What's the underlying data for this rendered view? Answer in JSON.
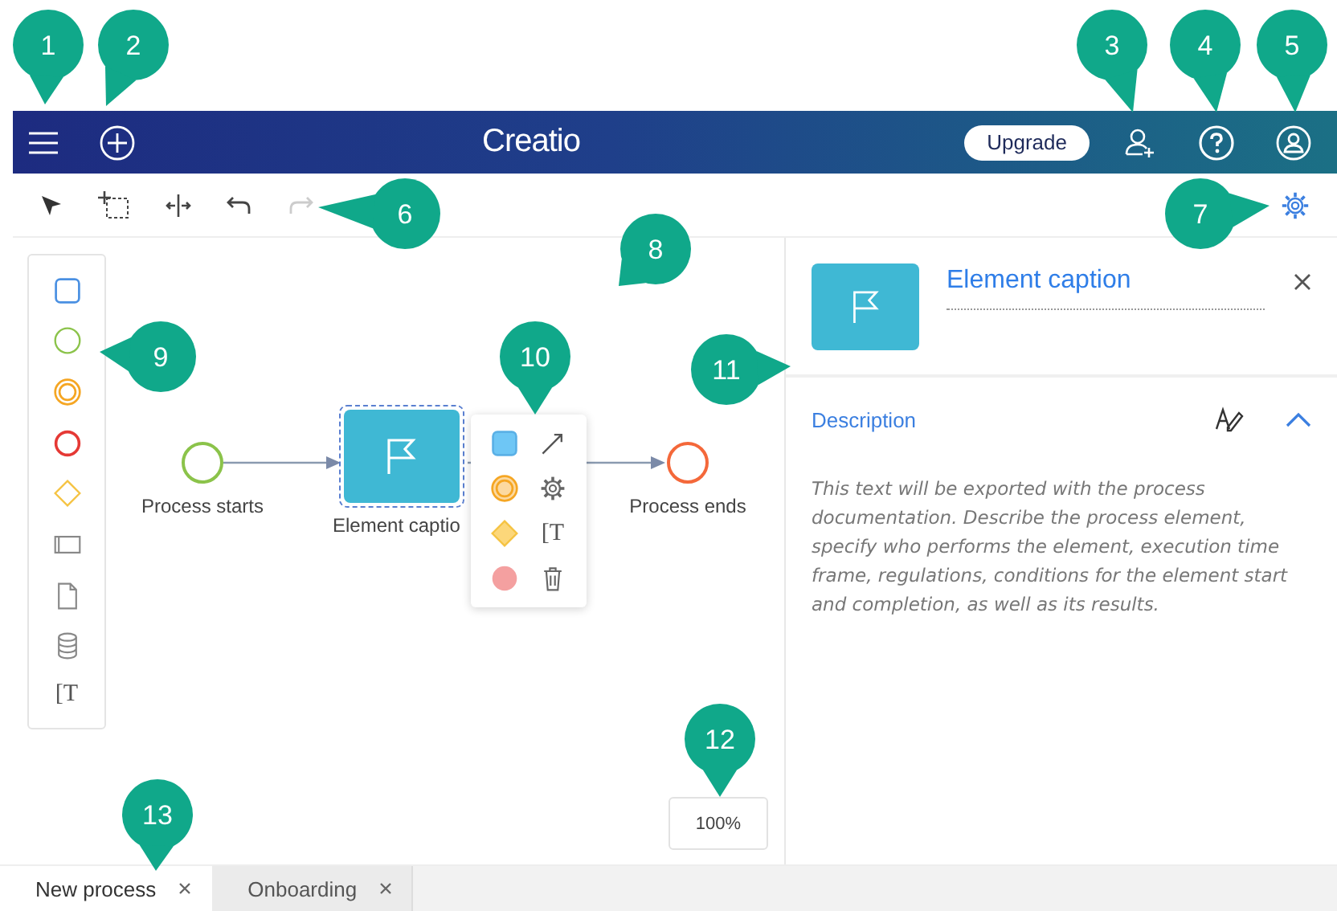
{
  "callouts": [
    "1",
    "2",
    "3",
    "4",
    "5",
    "6",
    "7",
    "8",
    "9",
    "10",
    "11",
    "12",
    "13"
  ],
  "header": {
    "logo": "Creatio",
    "upgrade_button": "Upgrade"
  },
  "toolbar": [
    {
      "kind": "pointer",
      "disabled": false
    },
    {
      "kind": "marquee",
      "disabled": false
    },
    {
      "kind": "distribute",
      "disabled": false
    },
    {
      "kind": "undo",
      "disabled": false
    },
    {
      "kind": "redo",
      "disabled": true
    }
  ],
  "palette": [
    {
      "kind": "task"
    },
    {
      "kind": "start"
    },
    {
      "kind": "intermediate"
    },
    {
      "kind": "end"
    },
    {
      "kind": "gateway"
    },
    {
      "kind": "pool"
    },
    {
      "kind": "document"
    },
    {
      "kind": "datastore"
    },
    {
      "kind": "annotation",
      "glyph": "[T"
    }
  ],
  "diagram": {
    "nodes": [
      {
        "kind": "start",
        "label": "Process starts",
        "selected": false
      },
      {
        "kind": "task",
        "label": "Element captio",
        "selected": true
      },
      {
        "kind": "end",
        "label": "Process ends",
        "selected": false
      }
    ],
    "quick_menu": [
      {
        "kind": "task"
      },
      {
        "kind": "connector"
      },
      {
        "kind": "intermediate"
      },
      {
        "kind": "settings"
      },
      {
        "kind": "gateway"
      },
      {
        "kind": "annotation",
        "glyph": "[T"
      },
      {
        "kind": "end"
      },
      {
        "kind": "delete"
      }
    ],
    "zoom": "100%"
  },
  "panel": {
    "caption": "Element caption",
    "section": "Description",
    "expanded": true,
    "description": "This text will be exported with the process documentation. Describe the process element, specify who performs the element, execution time frame, regulations, conditions for the element start and completion, as well as its results."
  },
  "tabs": [
    {
      "label": "New process",
      "selected": true
    },
    {
      "label": "Onboarding",
      "selected": false
    }
  ]
}
